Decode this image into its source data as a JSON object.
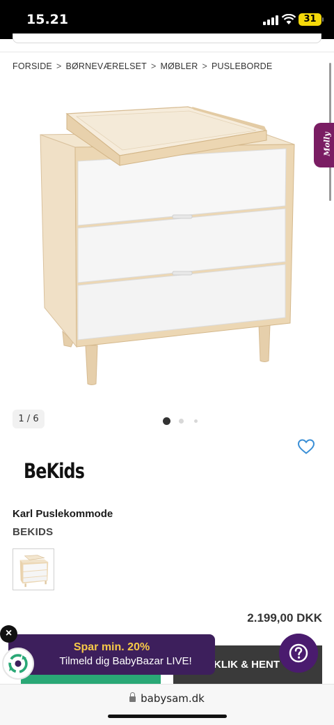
{
  "status_bar": {
    "time": "15.21",
    "battery": "31"
  },
  "breadcrumb": [
    "FORSIDE",
    "BØRNEVÆRELSET",
    "MØBLER",
    "PUSLEBORDE"
  ],
  "side_tab": {
    "label": "Molly"
  },
  "gallery": {
    "counter": "1 / 6",
    "total_dots": 3,
    "active_dot": 0
  },
  "product": {
    "brand_logo": "BeKids",
    "title": "Karl Puslekommode",
    "brand": "BEKIDS",
    "price": "2.199,00 DKK"
  },
  "actions": {
    "click_collect": "KLIK & HENT"
  },
  "promo": {
    "title": "Spar min. 20%",
    "subtitle": "Tilmeld dig BabyBazar LIVE!",
    "close": "×"
  },
  "help": {
    "icon": "question-icon"
  },
  "browser": {
    "url": "babysam.dk"
  },
  "colors": {
    "promo_bg": "#3d1f5c",
    "promo_title": "#f7c948",
    "green_button": "#2aa876",
    "dark_button": "#3a3a3a",
    "molly_tab": "#7a1d63",
    "heart": "#3a8fd6"
  }
}
